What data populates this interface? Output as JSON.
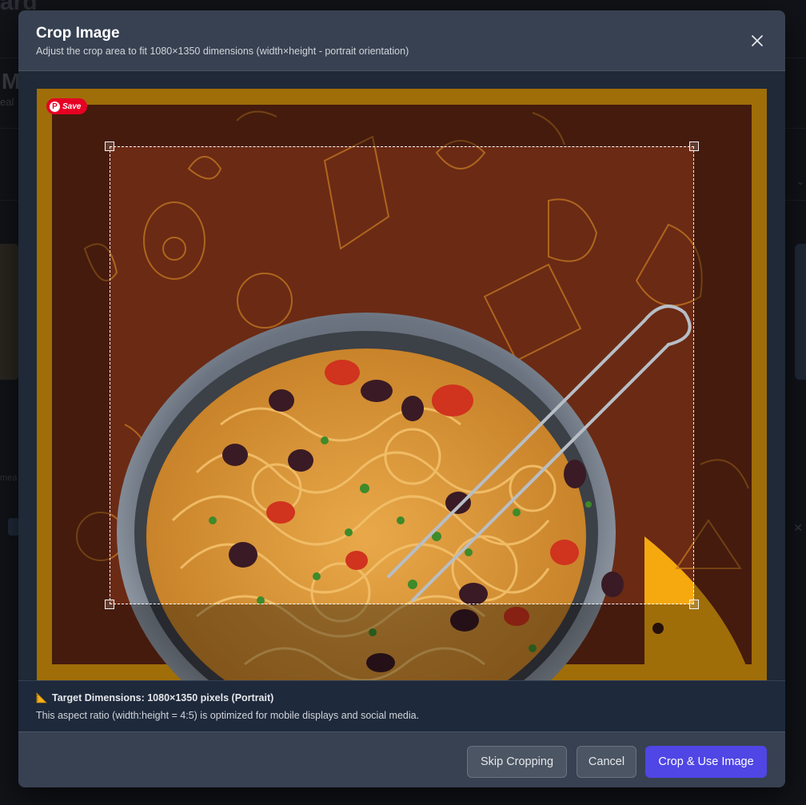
{
  "background_page": {
    "title_fragment": "ard",
    "heading_fragment": "M",
    "sub_fragment": "eal",
    "chip_fragment": "mea"
  },
  "modal": {
    "title": "Crop Image",
    "subtitle": "Adjust the crop area to fit 1080×1350 dimensions (width×height - portrait orientation)",
    "close_icon": "close-icon"
  },
  "image": {
    "pinterest_save_label": "Save",
    "colors": {
      "frame": "#f5a90f",
      "background": "#6b2a14",
      "doodle": "#c47a22"
    }
  },
  "info": {
    "icon": "triangular-ruler-icon",
    "title": "Target Dimensions: 1080×1350 pixels (Portrait)",
    "text": "This aspect ratio (width:height = 4:5) is optimized for mobile displays and social media."
  },
  "footer": {
    "skip_label": "Skip Cropping",
    "cancel_label": "Cancel",
    "crop_label": "Crop & Use Image"
  },
  "colors": {
    "accent": "#4f46e5",
    "pinterest": "#e60023"
  }
}
